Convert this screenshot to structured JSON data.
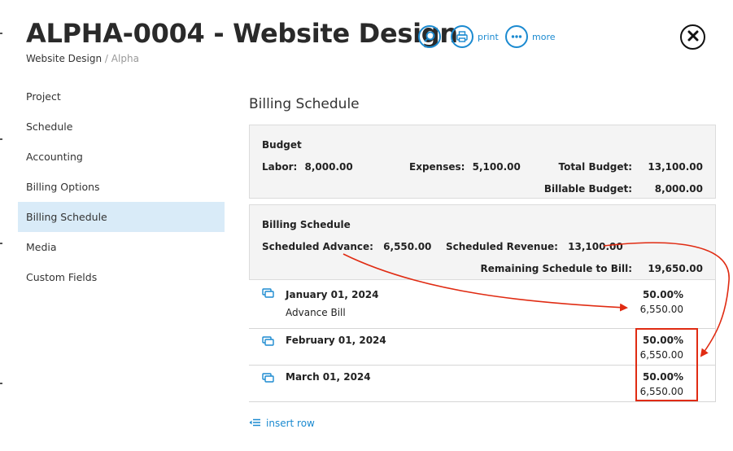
{
  "header": {
    "title": "ALPHA-0004 - Website Design",
    "breadcrumb": {
      "project": "Website Design",
      "separator": "/",
      "client": "Alpha"
    },
    "tools": [
      {
        "icon": "search-icon",
        "label": ""
      },
      {
        "icon": "print-icon",
        "label": "print"
      },
      {
        "icon": "more-icon",
        "label": "more"
      }
    ],
    "close_icon": "close-icon"
  },
  "sidebar": {
    "items": [
      {
        "label": "Project",
        "active": false
      },
      {
        "label": "Schedule",
        "active": false
      },
      {
        "label": "Accounting",
        "active": false
      },
      {
        "label": "Billing Options",
        "active": false
      },
      {
        "label": "Billing Schedule",
        "active": true
      },
      {
        "label": "Media",
        "active": false
      },
      {
        "label": "Custom Fields",
        "active": false
      }
    ]
  },
  "main": {
    "title": "Billing Schedule",
    "budget": {
      "title": "Budget",
      "labor_label": "Labor:",
      "labor_value": "8,000.00",
      "expenses_label": "Expenses:",
      "expenses_value": "5,100.00",
      "total_label": "Total Budget:",
      "total_value": "13,100.00",
      "billable_label": "Billable Budget:",
      "billable_value": "8,000.00"
    },
    "schedule_summary": {
      "title": "Billing Schedule",
      "advance_label": "Scheduled Advance:",
      "advance_value": "6,550.00",
      "revenue_label": "Scheduled Revenue:",
      "revenue_value": "13,100.00",
      "remaining_label": "Remaining Schedule to Bill:",
      "remaining_value": "19,650.00"
    },
    "rows": [
      {
        "date": "January 01, 2024",
        "note": "Advance Bill",
        "percent": "50.00%",
        "amount": "6,550.00"
      },
      {
        "date": "February 01, 2024",
        "note": "",
        "percent": "50.00%",
        "amount": "6,550.00"
      },
      {
        "date": "March 01, 2024",
        "note": "",
        "percent": "50.00%",
        "amount": "6,550.00"
      }
    ],
    "insert_row_label": "insert row"
  },
  "colors": {
    "accent": "#1b8ad0",
    "annotation": "#e02b12",
    "active_bg": "#d9ebf8",
    "panel_bg": "#f4f4f4"
  }
}
